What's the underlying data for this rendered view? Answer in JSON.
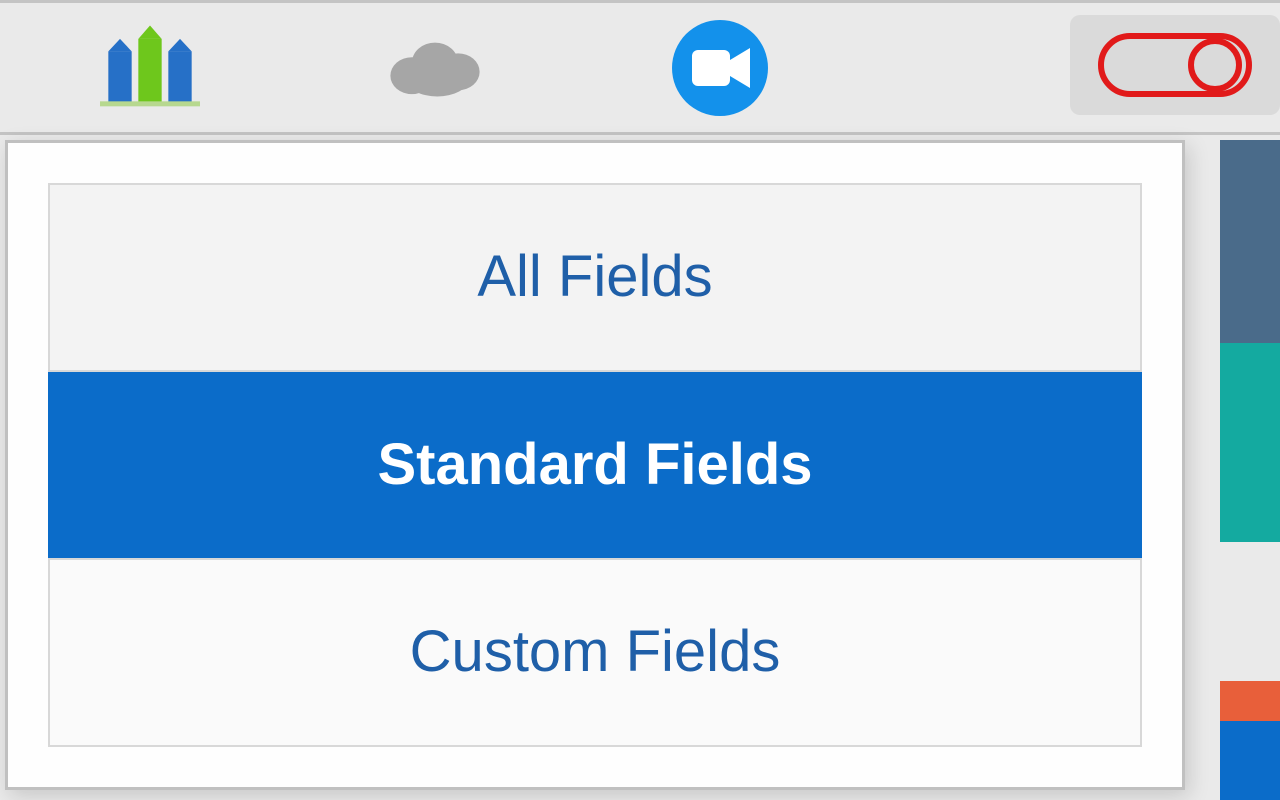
{
  "toolbar": {
    "icons": {
      "tower": "tower-icon",
      "cloud": "cloud-icon",
      "zoom": "zoom-icon",
      "record": "record-icon"
    }
  },
  "dropdown": {
    "items": [
      {
        "label": "All Fields",
        "selected": false
      },
      {
        "label": "Standard Fields",
        "selected": true
      },
      {
        "label": "Custom Fields",
        "selected": false
      }
    ]
  },
  "colors": {
    "accent_blue": "#0b6cc9",
    "link_blue": "#1f5fa8",
    "teal": "#14aaa0",
    "orange": "#e85f3a",
    "slate": "#4a6b8a"
  }
}
